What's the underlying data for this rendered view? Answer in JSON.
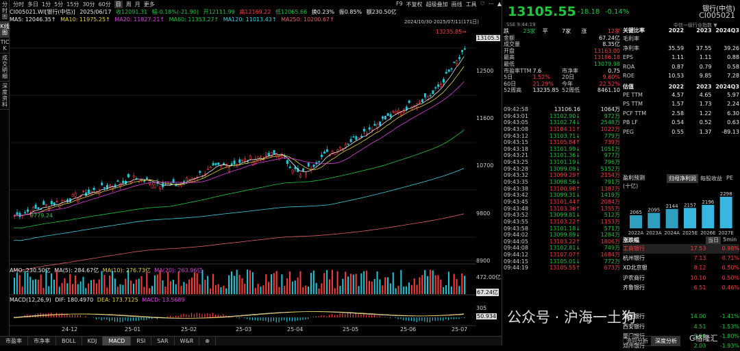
{
  "left_tabs": [
    "分时图",
    "K线图",
    "TICK",
    "成交明细",
    "深度资料"
  ],
  "top_bar": {
    "periods": [
      "分时",
      "多日",
      "1分",
      "5分",
      "15分",
      "30分",
      "60分",
      "日",
      "周",
      "月",
      "更多"
    ],
    "active": "日",
    "tools": [
      "F9",
      "不复权",
      "超级叠加",
      "画线",
      "工具"
    ],
    "win": [
      "♡",
      "⋯",
      "▲"
    ]
  },
  "info": {
    "code": "CI005021.WI[银行(中信)]",
    "date": "2025/06/17",
    "close": "收12091.31",
    "amp": "幅-0.18%(-21.90)",
    "open": "开12111.99",
    "high": "高12169.22",
    "low": "低12065.66",
    "turnover": "换0.23%",
    "swing": "振0.85%",
    "amount": "额230.50亿"
  },
  "ma": {
    "ma5": "MA5: 12046.35↑",
    "ma10": "MA10: 11975.25↑",
    "ma20": "MA20: 11827.21↑",
    "ma60": "MA60: 11353.27↑",
    "ma120": "MA120: 11013.43↑",
    "ma250": "MA250: 10200.67↑"
  },
  "range_label": "2024/10/30-2025/07/11(171日)",
  "price_axis": [
    "13105.5",
    "12500",
    "11600",
    "10700",
    "9800",
    "8900"
  ],
  "price_annot": {
    "high": "13235.85→",
    "low": "9779.24"
  },
  "sub1": {
    "amo": "AMO: 230.50亿",
    "ma5": "MA(5): 284.67亿",
    "ma10": "MA(10): 276.73亿",
    "ma20": "MA(20): 263.96亿",
    "axis_top": "472.00亿",
    "axis_val": "67.24亿"
  },
  "sub2": {
    "macd": "MACD(12,26,9)",
    "dif": "DIF: 180.4970",
    "dea": "DEA: 173.7125",
    "macd_v": "MACD: 13.5689",
    "axis_top": "305",
    "axis_val": "50.934"
  },
  "dates": [
    "24-12",
    "25-01",
    "25-02",
    "25-03",
    "25-04",
    "25-05",
    "25-06",
    "25-07"
  ],
  "bottom_tabs": [
    "市盈率",
    "市净率",
    "BOLL",
    "KDJ",
    "MACD",
    "RSI",
    "SAR",
    "W&R",
    "⊕"
  ],
  "quote": {
    "price": "13105.55",
    "chg": "-18.18",
    "pct": "-0.14%",
    "name": "银行(中信)",
    "code": "CI005021",
    "sse": "SSE 9:44:19",
    "industry": "中信一级行业指数 ▼",
    "rows": [
      {
        "k": "跌",
        "a": "23家",
        "b": "平",
        "c": "7家",
        "d": "涨",
        "e": "12家"
      },
      {
        "k": "金额",
        "v": "67.24亿"
      },
      {
        "k": "成交量",
        "v": "8.35亿"
      },
      {
        "k": "开盘",
        "v": "13163.00"
      },
      {
        "k": "最高",
        "v": "13186.18"
      },
      {
        "k": "最低",
        "v": "13079.98"
      },
      {
        "k": "市盈率TTM",
        "v1": "7.6",
        "k2": "市净率",
        "v2": "0.75"
      },
      {
        "k": "5日",
        "v1": "1.52%",
        "k2": "20日",
        "v2": "9.60%"
      },
      {
        "k": "60日",
        "v1": "21.29%",
        "k2": "今年",
        "v2": "22.52%"
      },
      {
        "k": "52周高",
        "v1": "13235.85",
        "k2": "52周低",
        "v2": "8461.10"
      }
    ]
  },
  "ticks": [
    [
      "09:42:58",
      "13106.16",
      "",
      "1064万"
    ],
    [
      "09:43:01",
      "13102.90",
      "↓",
      "972万"
    ],
    [
      "09:43:05",
      "13102.74",
      "↓",
      "2548万"
    ],
    [
      "09:43:08",
      "13104.11",
      "↑",
      "1022万"
    ],
    [
      "09:43:12",
      "13103.71",
      "↓",
      "779万"
    ],
    [
      "09:43:15",
      "13105.84",
      "↑",
      "739万"
    ],
    [
      "09:43:18",
      "13101.99",
      "↓",
      "1051万"
    ],
    [
      "09:43:21",
      "13101.36",
      "↓",
      "977万"
    ],
    [
      "09:43:25",
      "13101.19",
      "↓",
      "796万"
    ],
    [
      "09:43:28",
      "13099.09",
      "↓",
      "5152万"
    ],
    [
      "09:43:32",
      "13099.29",
      "↑",
      "2154万"
    ],
    [
      "09:43:35",
      "13098.56",
      "↓",
      "791万"
    ],
    [
      "09:43:38",
      "13100.98",
      "↑",
      "1387万"
    ],
    [
      "09:43:42",
      "13099.31",
      "↓",
      "1419万"
    ],
    [
      "09:43:45",
      "13101.44",
      "↑",
      "2084万"
    ],
    [
      "09:43:48",
      "13103.36",
      "↑",
      "1355万"
    ],
    [
      "09:43:52",
      "13099.81",
      "↓",
      "512万"
    ],
    [
      "09:43:55",
      "13103.22",
      "↑",
      "1153万"
    ],
    [
      "09:43:58",
      "13101.18",
      "↓",
      "571万"
    ],
    [
      "09:44:02",
      "13099.89",
      "↓",
      "1284万"
    ],
    [
      "09:44:05",
      "13103.22",
      "↑",
      "1806万"
    ],
    [
      "09:44:08",
      "13102.81",
      "↓",
      "749万"
    ],
    [
      "09:44:12",
      "13107.07",
      "↑",
      "1684万"
    ],
    [
      "09:44:15",
      "13105.01",
      "↓",
      "772万"
    ],
    [
      "09:44:19",
      "13105.55",
      "↑",
      "673万"
    ]
  ],
  "fin": {
    "title": "关键比率",
    "years": [
      "2022",
      "2023",
      "2024Q3"
    ],
    "rows": [
      [
        "毛利率",
        "",
        "",
        ""
      ],
      [
        "净利率",
        "35.59",
        "37.55",
        "39.26"
      ],
      [
        "EPS",
        "1.11",
        "1.11",
        "0.88"
      ],
      [
        "ROA",
        "0.87",
        "0.79",
        "0.58"
      ],
      [
        "ROE",
        "10.53",
        "9.85",
        "7.28"
      ]
    ],
    "val_title": "估值",
    "val_years": [
      "2022",
      "2023",
      "2024Q3"
    ],
    "val_rows": [
      [
        "PE TTM",
        "4.57",
        "4.65",
        "5.97"
      ],
      [
        "PS TTM",
        "1.57",
        "1.73",
        "2.24"
      ],
      [
        "PCF TTM",
        "2.58",
        "1.22",
        "6.30"
      ],
      [
        "PB LF",
        "0.54",
        "0.52",
        "0.63"
      ],
      [
        "PEG",
        "0.55",
        "1.37",
        "-89.13"
      ]
    ]
  },
  "forecast": {
    "title": "盈利预测",
    "unit": "(十亿)",
    "tabs": [
      "归母净利润",
      "每股收益",
      "PE"
    ],
    "active": "归母净利润"
  },
  "chart_data": {
    "type": "bar",
    "categories": [
      "2022A",
      "2023A",
      "2024A",
      "2025E",
      "2026E",
      "2027E"
    ],
    "values": [
      2065,
      2095,
      2144,
      2157,
      2196,
      2298
    ],
    "ylim": [
      1900,
      2350
    ]
  },
  "rank": {
    "title": "涨跌幅",
    "tabs": [
      "当日",
      "5min"
    ],
    "active": "当日",
    "rows": [
      [
        "工商银行",
        "17.53",
        "0.98%"
      ],
      [
        "杭州银行",
        "7.13",
        "0.71%"
      ],
      [
        "XD北京银",
        "8.12",
        "0.50%"
      ],
      [
        "沪农商行",
        "10.10",
        "0.50%"
      ],
      [
        "齐鲁银行",
        "6.51",
        "0.46%"
      ],
      [
        "",
        "",
        ""
      ],
      [
        "",
        "",
        ""
      ],
      [
        "浦发银行",
        "14.00",
        "-1.41%"
      ],
      [
        "西安银行",
        "4.51",
        "-1.53%"
      ],
      [
        "厦门银行",
        "5.99",
        "-1.80%"
      ],
      [
        "郑州银行",
        "2.03",
        "-1.93%"
      ]
    ]
  },
  "right_bottom_tabs": [
    "流向分析",
    "深度分析"
  ],
  "watermark": "公众号 · 沪海一土狗",
  "wm_logo": "G格隆汇"
}
